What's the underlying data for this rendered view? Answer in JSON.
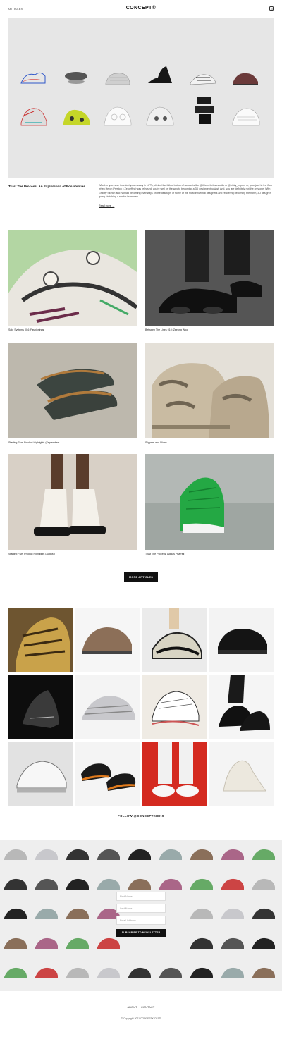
{
  "header": {
    "nav_articles": "ARTICLES",
    "logo": "CONCEPT®",
    "instagram_icon": "instagram-icon"
  },
  "featured": {
    "title": "Trust The Process: An Exploration of Possibilities",
    "excerpt": "Whether you have invested your money in NFTs, clicked the follow button of accounts like @thiccurlfetturestudio or @nicky_hopee, or, your jaw hit the floor when Heron Preston x Zeroeffect was released, you're well on the way to becoming a 3D design enthusiast. And, you are definitely not the only one. With Gravity Sketch and Nomad becoming mainstays on the desktops of some of the most influential designers and rendering becoming the norm, 3D design is going sketching a run for its money...",
    "read_more": "Read more →"
  },
  "articles": [
    {
      "caption": "Sole Systems 004: Fashionings"
    },
    {
      "caption": "Between The Lines 010: Zeeung Woo"
    },
    {
      "caption": "Starting Five: Product Highlights (September)"
    },
    {
      "caption": "Slippers and Slides"
    },
    {
      "caption": "Starting Five: Product Highlights (August)"
    },
    {
      "caption": "Trust The Process: Adidas Pharrell"
    }
  ],
  "more_articles_label": "MORE ARTICLES",
  "follow_label": "FOLLOW @CONCEPTKICKS",
  "newsletter": {
    "first_name_placeholder": "First Name",
    "last_name_placeholder": "Last Name",
    "email_placeholder": "Email Address",
    "subscribe_label": "SUBSCRIBE TO NEWSLETTER"
  },
  "footer": {
    "about": "ABOUT",
    "contact": "CONTACT",
    "copyright": "© Copyright 2021 CONCEPTKICKS®"
  },
  "colors": {
    "background": "#ffffff",
    "hero_bg": "#e6e6e6",
    "button": "#111111",
    "newsletter_bg": "#eeeeee"
  }
}
